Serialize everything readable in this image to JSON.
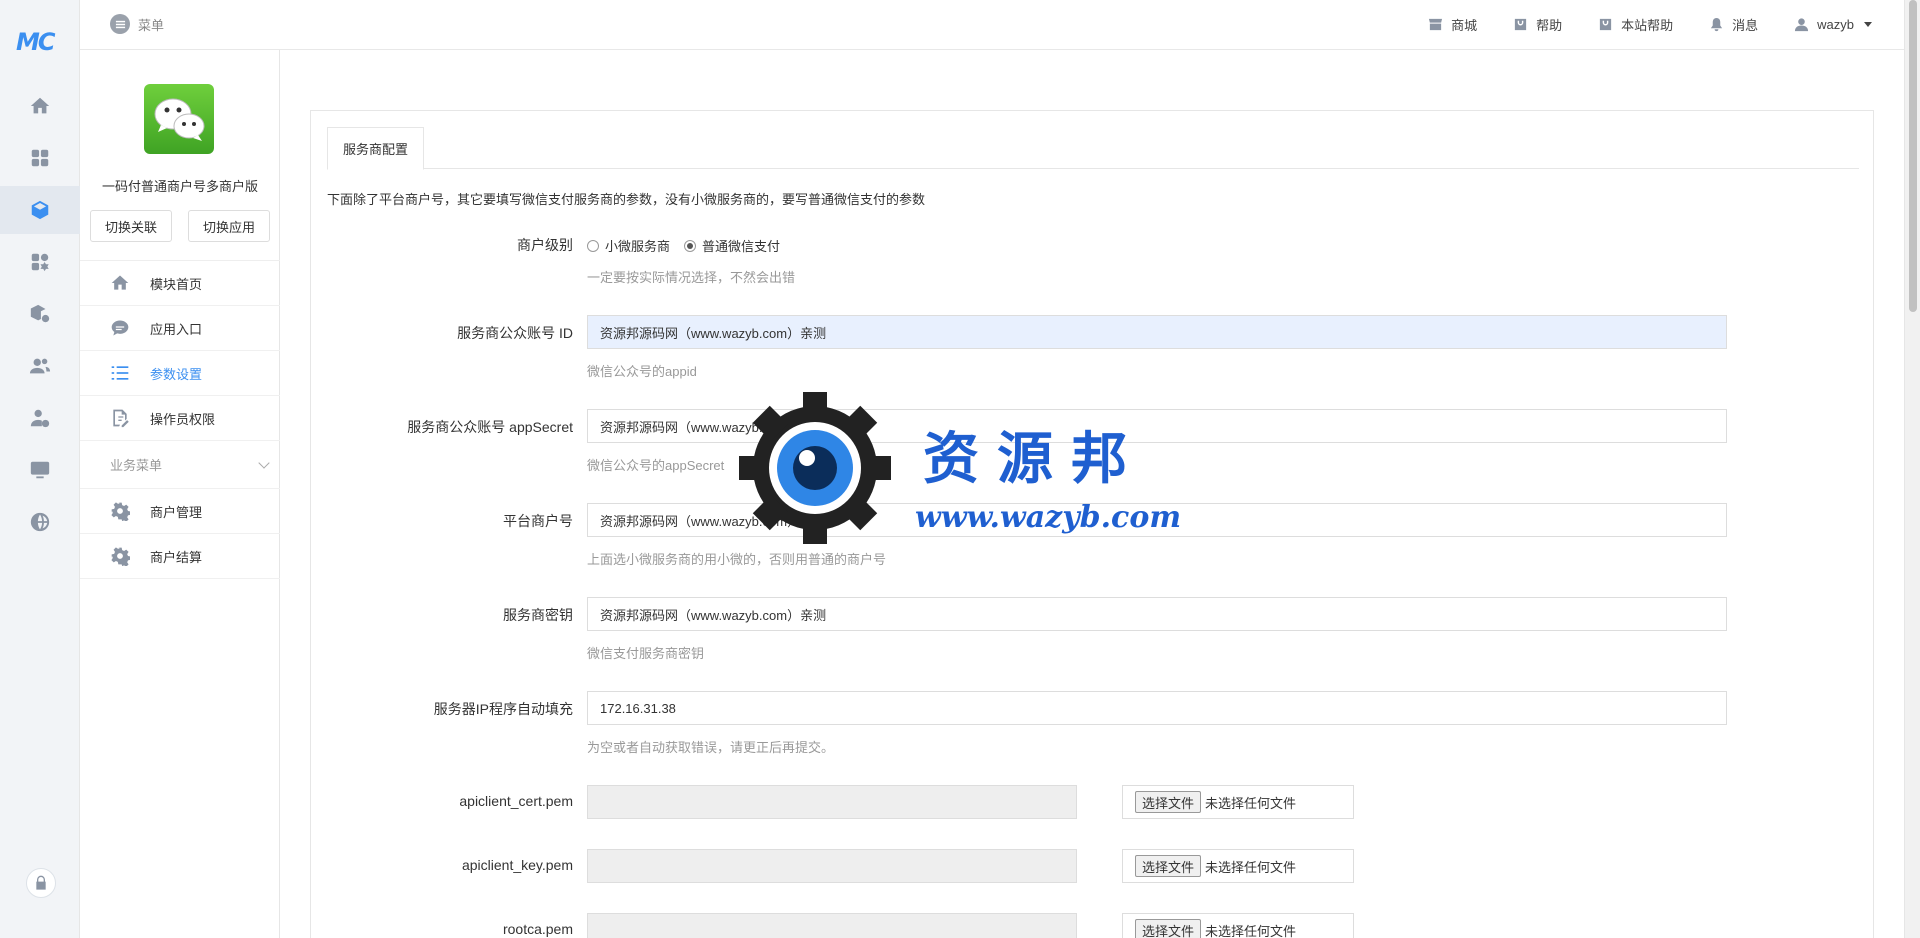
{
  "rail": {
    "logo": "MC",
    "items": [
      "home-icon",
      "apps-grid-icon",
      "module-cube-icon",
      "plugins-icon",
      "store-settings-icon",
      "users-icon",
      "user-settings-icon",
      "monitor-icon",
      "globe-icon"
    ],
    "active_index": 2,
    "bottom": "lock-icon"
  },
  "topbar": {
    "menu_label": "菜单",
    "links": [
      {
        "label": "商城",
        "icon": "store-icon"
      },
      {
        "label": "帮助",
        "icon": "help-bag-icon"
      },
      {
        "label": "本站帮助",
        "icon": "site-help-icon"
      },
      {
        "label": "消息",
        "icon": "bell-icon"
      }
    ],
    "user": "wazyb"
  },
  "module": {
    "name": "一码付普通商户号多商户版",
    "switch_link": "切换关联",
    "switch_app": "切换应用",
    "nav": [
      {
        "label": "模块首页",
        "icon": "home-icon"
      },
      {
        "label": "应用入口",
        "icon": "chat-bubble-icon"
      },
      {
        "label": "参数设置",
        "icon": "list-icon"
      },
      {
        "label": "操作员权限",
        "icon": "edit-doc-icon"
      }
    ],
    "active_nav": 2,
    "group_label": "业务菜单",
    "group_items": [
      {
        "label": "商户管理",
        "icon": "gear-icon"
      },
      {
        "label": "商户结算",
        "icon": "gear-icon"
      }
    ]
  },
  "main": {
    "tab": "服务商配置",
    "intro": "下面除了平台商户号，其它要填写微信支付服务商的参数，没有小微服务商的，要写普通微信支付的参数",
    "merchant_level": {
      "label": "商户级别",
      "options": [
        "小微服务商",
        "普通微信支付"
      ],
      "selected": 1,
      "hint": "一定要按实际情况选择，不然会出错"
    },
    "fields": [
      {
        "label": "服务商公众账号 ID",
        "value": "资源邦源码网（www.wazyb.com）亲测",
        "hint": "微信公众号的appid"
      },
      {
        "label": "服务商公众账号 appSecret",
        "value": "资源邦源码网（www.wazyb.com）亲测",
        "hint": "微信公众号的appSecret"
      },
      {
        "label": "平台商户号",
        "value": "资源邦源码网（www.wazyb.com）亲测",
        "hint": "上面选小微服务商的用小微的，否则用普通的商户号"
      },
      {
        "label": "服务商密钥",
        "value": "资源邦源码网（www.wazyb.com）亲测",
        "hint": "微信支付服务商密钥"
      },
      {
        "label": "服务器IP程序自动填充",
        "value": "172.16.31.38",
        "hint": "为空或者自动获取错误，请更正后再提交。"
      }
    ],
    "files": [
      {
        "label": "apiclient_cert.pem",
        "button": "选择文件",
        "status": "未选择任何文件"
      },
      {
        "label": "apiclient_key.pem",
        "button": "选择文件",
        "status": "未选择任何文件"
      },
      {
        "label": "rootca.pem",
        "button": "选择文件",
        "status": "未选择任何文件"
      }
    ]
  },
  "watermark": {
    "title": "资源邦",
    "url": "www.wazyb.com"
  },
  "colors": {
    "accent": "#3b8ff0",
    "wechat_green": "#4caf2f",
    "watermark_blue": "#1f5fd0"
  }
}
